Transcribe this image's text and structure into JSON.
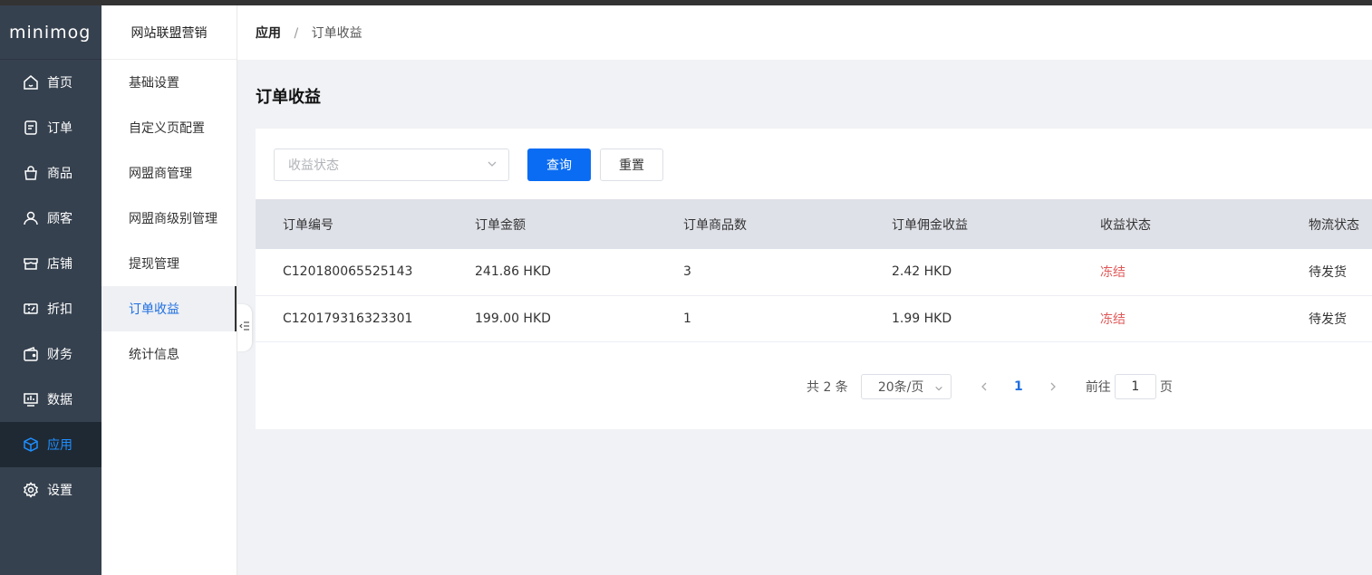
{
  "app": {
    "logo": "minimog"
  },
  "sidebar": {
    "items": [
      {
        "label": "首页",
        "icon": "home-icon"
      },
      {
        "label": "订单",
        "icon": "order-icon"
      },
      {
        "label": "商品",
        "icon": "bag-icon"
      },
      {
        "label": "顾客",
        "icon": "user-icon"
      },
      {
        "label": "店铺",
        "icon": "store-icon"
      },
      {
        "label": "折扣",
        "icon": "ticket-icon"
      },
      {
        "label": "财务",
        "icon": "wallet-icon"
      },
      {
        "label": "数据",
        "icon": "chart-icon"
      },
      {
        "label": "应用",
        "icon": "box-icon",
        "active": true
      },
      {
        "label": "设置",
        "icon": "gear-icon"
      }
    ],
    "active_color": "#1f8fff"
  },
  "submenu": {
    "title": "网站联盟营销",
    "items": [
      {
        "label": "基础设置"
      },
      {
        "label": "自定义页配置"
      },
      {
        "label": "网盟商管理"
      },
      {
        "label": "网盟商级别管理"
      },
      {
        "label": "提现管理"
      },
      {
        "label": "订单收益",
        "active": true
      },
      {
        "label": "统计信息"
      }
    ]
  },
  "breadcrumb": {
    "root": "应用",
    "sep": "/",
    "current": "订单收益"
  },
  "page": {
    "title": "订单收益"
  },
  "filter": {
    "status_placeholder": "收益状态",
    "query_label": "查询",
    "reset_label": "重置"
  },
  "table": {
    "columns": [
      "订单编号",
      "订单金额",
      "订单商品数",
      "订单佣金收益",
      "收益状态",
      "物流状态"
    ],
    "rows": [
      [
        "C120180065525143",
        "241.86 HKD",
        "3",
        "2.42 HKD",
        "冻结",
        "待发货"
      ],
      [
        "C120179316323301",
        "199.00 HKD",
        "1",
        "1.99 HKD",
        "冻结",
        "待发货"
      ]
    ]
  },
  "pagination": {
    "total": "共 2 条",
    "page_size": "20条/页",
    "current_page": "1",
    "goto_label": "前往",
    "goto_value": "1",
    "page_suffix": "页"
  },
  "colors": {
    "primary": "#0a6cf2",
    "status_frozen": "#e05a5a",
    "sidebar_bg": "#36414f"
  }
}
